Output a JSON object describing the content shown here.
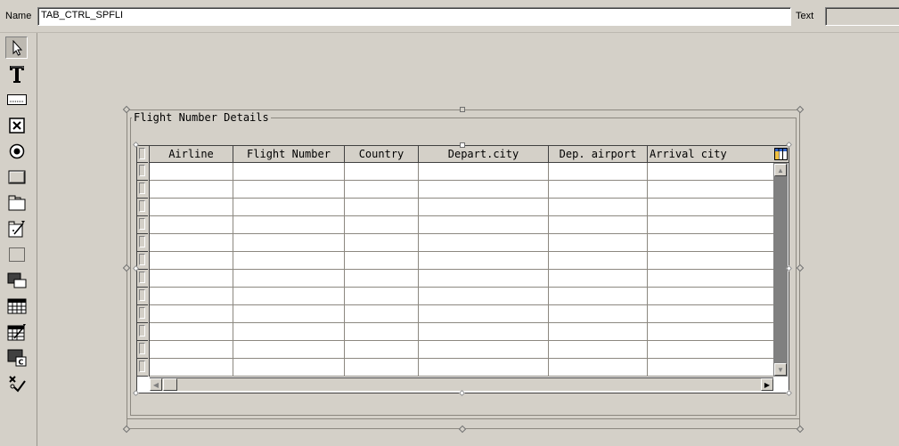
{
  "header": {
    "name_label": "Name",
    "name_value": "TAB_CTRL_SPFLI",
    "text_label": "Text",
    "text_value": ""
  },
  "toolbar": {
    "tools": [
      {
        "icon": "pointer-icon",
        "selected": true
      },
      {
        "icon": "text-field-icon"
      },
      {
        "icon": "input-field-icon"
      },
      {
        "icon": "checkbox-icon"
      },
      {
        "icon": "radio-button-icon"
      },
      {
        "icon": "pushbutton-icon"
      },
      {
        "icon": "tabstrip-icon"
      },
      {
        "icon": "tabstrip-wizard-icon"
      },
      {
        "icon": "box-icon"
      },
      {
        "icon": "subscreen-icon"
      },
      {
        "icon": "table-control-icon"
      },
      {
        "icon": "table-control-wizard-icon"
      },
      {
        "icon": "custom-control-icon"
      },
      {
        "icon": "status-icon"
      }
    ]
  },
  "group": {
    "title": "Flight Number Details"
  },
  "table": {
    "columns": [
      "Airline",
      "Flight Number",
      "Country",
      "Depart.city",
      "Dep. airport",
      "Arrival city"
    ],
    "row_count": 12
  },
  "colors": {
    "background": "#d4d0c8",
    "cell": "#ffffff",
    "scroll_track": "#808080"
  }
}
